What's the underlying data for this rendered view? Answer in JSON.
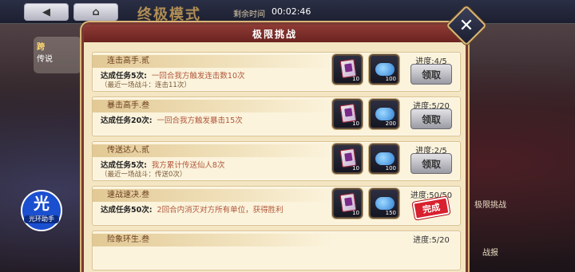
{
  "topbar": {
    "back_label": "",
    "mode_title": "终极模式",
    "timer_label": "剩余时间",
    "timer_value": "00:02:46"
  },
  "side": {
    "left_line1": "跨",
    "left_line2": "传说"
  },
  "right_buttons": [
    "极限挑战",
    "战报"
  ],
  "badge": {
    "glyph": "光",
    "label": "光环助手"
  },
  "panel": {
    "title": "极限挑战",
    "tasks": [
      {
        "title": "连击高手.贰",
        "count_text": "达成任务5次:",
        "desc": "一回合我方触发连击数10次",
        "recent": "（最近一场战斗：连击11次）",
        "rewards": [
          {
            "icon": "card-icon",
            "qty": "10"
          },
          {
            "icon": "cloud-jade-icon",
            "qty": "100"
          }
        ],
        "progress": "进度:4/5",
        "action": "领取",
        "completed": false
      },
      {
        "title": "暴击高手.叁",
        "count_text": "达成任务20次:",
        "desc": "一回合我方触发暴击15次",
        "recent": "",
        "rewards": [
          {
            "icon": "card-icon",
            "qty": "10"
          },
          {
            "icon": "cloud-jade-icon",
            "qty": "200"
          }
        ],
        "progress": "进度:5/20",
        "action": "领取",
        "completed": false
      },
      {
        "title": "传送达人.贰",
        "count_text": "达成任务5次:",
        "desc": "我方累计传送仙人8次",
        "recent": "（最近一场战斗：传送0次）",
        "rewards": [
          {
            "icon": "card-icon",
            "qty": "10"
          },
          {
            "icon": "cloud-jade-icon",
            "qty": "100"
          }
        ],
        "progress": "进度:2/5",
        "action": "领取",
        "completed": false
      },
      {
        "title": "速战速决.叁",
        "count_text": "达成任务50次:",
        "desc": "2回合内消灭对方所有单位，获得胜利",
        "recent": "",
        "rewards": [
          {
            "icon": "card-icon",
            "qty": "10"
          },
          {
            "icon": "cloud-jade-icon",
            "qty": "150"
          }
        ],
        "progress": "进度:50/50",
        "action": "完成",
        "completed": true
      },
      {
        "title": "险象环生.叁",
        "count_text": "",
        "desc": "",
        "recent": "",
        "rewards": [],
        "progress": "进度:5/20",
        "action": "",
        "completed": false
      }
    ]
  }
}
